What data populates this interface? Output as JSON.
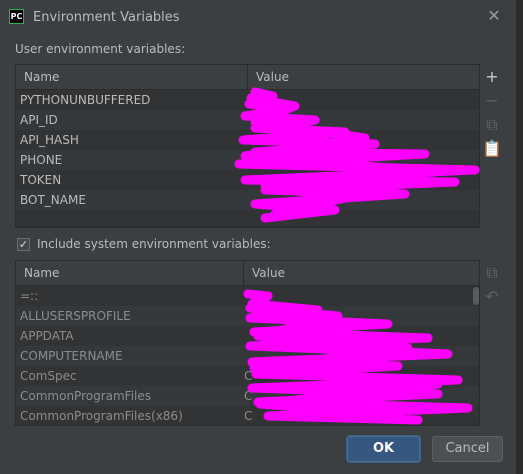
{
  "window": {
    "title": "Environment Variables",
    "app_icon_text": "PC",
    "close_glyph": "✕"
  },
  "user_vars": {
    "label": "User environment variables:",
    "col_name": "Name",
    "col_value": "Value",
    "rows": [
      {
        "name": "PYTHONUNBUFFERED",
        "value": ""
      },
      {
        "name": "API_ID",
        "value": ""
      },
      {
        "name": "API_HASH",
        "value": ""
      },
      {
        "name": "PHONE",
        "value": ""
      },
      {
        "name": "TOKEN",
        "value": ""
      },
      {
        "name": "BOT_NAME",
        "value": ""
      }
    ],
    "toolbar": [
      {
        "icon": "plus-icon",
        "glyph": "+",
        "enabled": true
      },
      {
        "icon": "minus-icon",
        "glyph": "−",
        "enabled": false
      },
      {
        "icon": "copy-icon",
        "glyph": "⧉",
        "enabled": false
      },
      {
        "icon": "paste-icon",
        "glyph": "📋",
        "enabled": true
      }
    ]
  },
  "system_vars": {
    "checkbox_label": "Include system environment variables:",
    "checked": true,
    "col_name": "Name",
    "col_value": "Value",
    "rows": [
      {
        "name": "=::",
        "value": ""
      },
      {
        "name": "ALLUSERSPROFILE",
        "value": ""
      },
      {
        "name": "APPDATA",
        "value": ""
      },
      {
        "name": "COMPUTERNAME",
        "value": ""
      },
      {
        "name": "ComSpec",
        "value": "C"
      },
      {
        "name": "CommonProgramFiles",
        "value": "C"
      },
      {
        "name": "CommonProgramFiles(x86)",
        "value": "C"
      }
    ],
    "toolbar": [
      {
        "icon": "copy-icon",
        "glyph": "⧉",
        "enabled": false
      },
      {
        "icon": "undo-icon",
        "glyph": "↶",
        "enabled": false
      }
    ]
  },
  "buttons": {
    "ok": "OK",
    "cancel": "Cancel"
  },
  "colors": {
    "background": "#3c3f41",
    "table_bg": "#313335",
    "redaction": "#ff00ff",
    "ok_button": "#365880"
  }
}
